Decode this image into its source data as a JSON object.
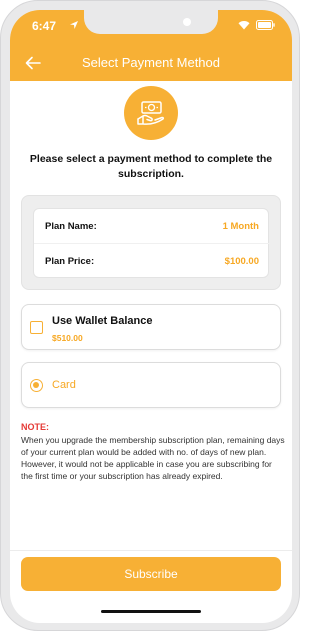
{
  "status_bar": {
    "time": "6:47",
    "icons": [
      "location-arrow-icon",
      "wifi-icon",
      "battery-icon"
    ]
  },
  "header": {
    "title": "Select Payment Method",
    "back_icon": "arrow-left-icon"
  },
  "hero": {
    "icon": "hand-cash-icon",
    "instruction": "Please select a payment method to complete the subscription."
  },
  "plan": {
    "name_label": "Plan Name:",
    "name_value": "1 Month",
    "price_label": "Plan Price:",
    "price_value": "$100.00"
  },
  "options": {
    "wallet": {
      "label": "Use Wallet Balance",
      "amount": "$510.00",
      "checked": false
    },
    "card": {
      "label": "Card",
      "selected": true
    }
  },
  "note": {
    "title": "NOTE",
    "colon": ":",
    "text": "When you upgrade the membership subscription plan, remaining days of your current plan would be added with no. of days of new plan. However, it would not be applicable in case you are subscribing for the first time or your subscription has already expired."
  },
  "footer": {
    "subscribe_label": "Subscribe"
  },
  "colors": {
    "accent": "#f7b035",
    "accent_text": "#f7a823",
    "note_title": "#e53935"
  }
}
